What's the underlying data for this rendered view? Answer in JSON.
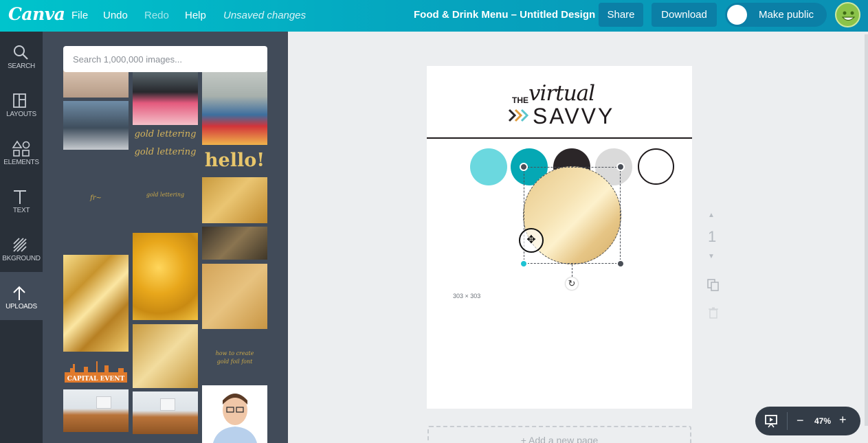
{
  "topbar": {
    "logo": "Canva",
    "menu": {
      "file": "File",
      "undo": "Undo",
      "redo": "Redo",
      "help": "Help"
    },
    "save_status": "Unsaved changes",
    "doc_title": "Food & Drink Menu – Untitled Design",
    "share": "Share",
    "download": "Download",
    "make_public": "Make public"
  },
  "rail": {
    "search": "SEARCH",
    "layouts": "LAYOUTS",
    "elements": "ELEMENTS",
    "text": "TEXT",
    "background": "BKGROUND",
    "uploads": "UPLOADS"
  },
  "panel": {
    "search_placeholder": "Search 1,000,000 images...",
    "thumb_texts": {
      "gold_lettering_1": "gold lettering",
      "gold_lettering_2": "gold lettering",
      "hello": "hello!",
      "gold_small": "gold lettering",
      "capital_event": "CAPITAL EVENT",
      "how_to": "how to create",
      "gold_foil": "gold foil font"
    }
  },
  "canvas": {
    "logo_the": "THE",
    "logo_virtual": "virtual",
    "logo_savvy": "SAVVY",
    "size_label": "303 × 303",
    "page_number": "1",
    "add_page": "+ Add a new page",
    "swatches": [
      "#6bd8df",
      "#05a8b4",
      "#2b2628",
      "#dadada",
      "#ffffff"
    ]
  },
  "zoom": {
    "level": "47%",
    "minus": "−",
    "plus": "+"
  }
}
